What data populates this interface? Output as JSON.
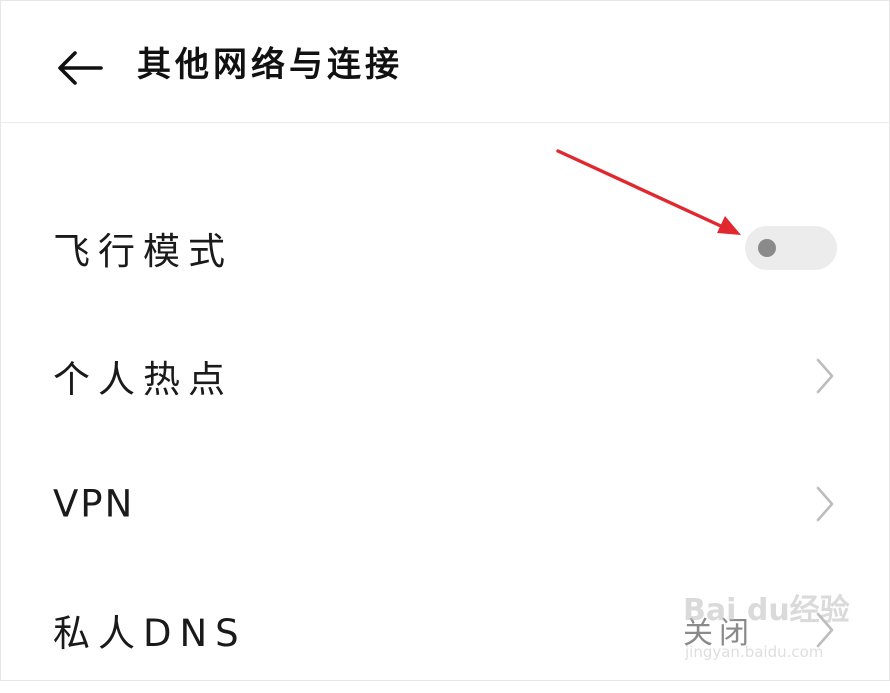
{
  "header": {
    "title": "其他网络与连接",
    "back_icon": "arrow-left-icon"
  },
  "rows": [
    {
      "label": "飞行模式",
      "control": "toggle",
      "toggle_on": false
    },
    {
      "label": "个人热点",
      "control": "chevron",
      "icon": "chevron-right-icon"
    },
    {
      "label": "VPN",
      "control": "chevron",
      "icon": "chevron-right-icon"
    },
    {
      "label": "私人DNS",
      "control": "value",
      "value": "关闭",
      "icon": "chevron-right-icon"
    }
  ],
  "colors": {
    "annotation_arrow": "#e0282e",
    "toggle_track": "#ececec",
    "toggle_knob": "#8a8a8a",
    "chevron": "#bdbdbd",
    "divider": "#ececec"
  },
  "watermark": {
    "brand": "Bai du经验",
    "url": "jingyan.baidu.com"
  }
}
